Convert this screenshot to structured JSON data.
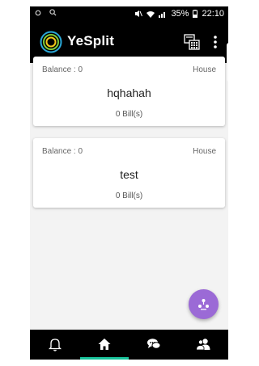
{
  "status_bar": {
    "battery": "35%",
    "time": "22:10"
  },
  "app_bar": {
    "title": "YeSplit",
    "logo_icon": "yesplit-rings-logo",
    "actions": [
      "calculator-icon",
      "more-vert-icon"
    ]
  },
  "groups": [
    {
      "balance": "Balance : 0",
      "type": "House",
      "name": "hqhahah",
      "bills": "0 Bill(s)"
    },
    {
      "balance": "Balance : 0",
      "type": "House",
      "name": "test",
      "bills": "0 Bill(s)"
    }
  ],
  "fab": {
    "icon": "add-group-icon",
    "color": "#9b6ad6"
  },
  "bottom_nav": {
    "items": [
      "notifications-icon",
      "home-icon",
      "chat-icon",
      "people-icon"
    ],
    "selected": "home-icon",
    "indicator_color": "#19c39c"
  }
}
